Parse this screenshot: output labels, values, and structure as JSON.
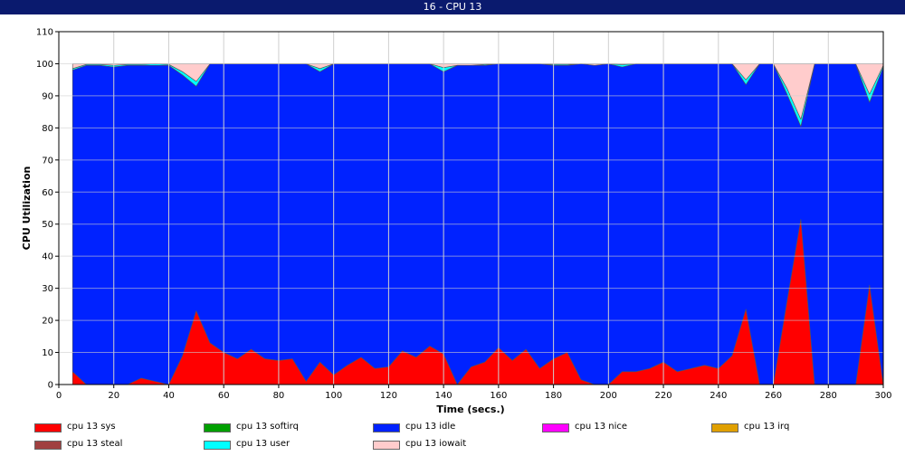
{
  "window": {
    "title": "16 - CPU 13"
  },
  "chart_data": {
    "type": "area",
    "title": "16 - CPU 13",
    "xlabel": "Time (secs.)",
    "ylabel": "CPU Utilization",
    "xlim": [
      0,
      300
    ],
    "ylim": [
      0,
      110
    ],
    "x_ticks": [
      0,
      20,
      40,
      60,
      80,
      100,
      120,
      140,
      160,
      180,
      200,
      220,
      240,
      260,
      280,
      300
    ],
    "y_ticks": [
      0,
      10,
      20,
      30,
      40,
      50,
      60,
      70,
      80,
      90,
      100,
      110
    ],
    "stacked": true,
    "grid": true,
    "legend_position": "bottom",
    "x": [
      5,
      10,
      15,
      20,
      25,
      30,
      35,
      40,
      45,
      50,
      55,
      60,
      65,
      70,
      75,
      80,
      85,
      90,
      95,
      100,
      105,
      110,
      115,
      120,
      125,
      130,
      135,
      140,
      145,
      150,
      155,
      160,
      165,
      170,
      175,
      180,
      185,
      190,
      195,
      200,
      205,
      210,
      215,
      220,
      225,
      230,
      235,
      240,
      245,
      250,
      255,
      260,
      265,
      270,
      275,
      280,
      285,
      290,
      295,
      300
    ],
    "series": [
      {
        "name": "cpu 13 sys",
        "color": "#ff0000",
        "values": [
          4,
          0,
          0,
          0,
          0,
          2,
          1,
          0,
          9,
          23,
          13,
          10,
          8,
          11,
          8,
          7.5,
          8,
          1,
          7,
          3,
          6,
          8.5,
          5,
          5.5,
          10.5,
          8.5,
          12,
          9.5,
          0,
          5.5,
          7,
          11.5,
          7.5,
          11,
          5,
          8,
          10,
          1.5,
          0,
          0,
          4,
          4,
          5,
          7,
          4,
          5,
          6,
          5,
          9,
          23.5,
          0,
          0,
          26,
          51.5,
          0,
          0,
          0,
          0,
          31,
          0
        ]
      },
      {
        "name": "cpu 13 softirq",
        "color": "#00a000",
        "values": [
          0,
          0,
          0,
          0,
          0,
          0,
          0,
          0,
          0,
          0,
          0,
          0,
          0,
          0,
          0,
          0,
          0,
          0,
          0,
          0,
          0,
          0,
          0,
          0,
          0,
          0,
          0,
          0,
          0,
          0,
          0,
          0,
          0,
          0,
          0,
          0,
          0,
          0,
          0,
          0,
          0,
          0,
          0,
          0,
          0,
          0,
          0,
          0,
          0,
          0,
          0,
          0,
          0,
          0,
          0,
          0,
          0,
          0,
          0,
          0
        ]
      },
      {
        "name": "cpu 13 idle",
        "color": "#0022ff",
        "values": [
          94,
          99.5,
          99.5,
          99,
          99.5,
          97.5,
          98.5,
          99.5,
          87.5,
          70,
          87,
          90,
          92,
          89,
          92,
          92.5,
          92,
          99,
          90.5,
          97,
          94,
          91.5,
          95,
          94.5,
          89.5,
          91.5,
          88,
          88,
          99.5,
          94,
          92.5,
          88.5,
          92.5,
          89,
          95,
          91.5,
          89.5,
          98.5,
          99.5,
          100,
          95,
          96,
          95,
          93,
          96,
          95,
          94,
          95,
          91,
          70,
          100,
          100,
          64.5,
          29,
          100,
          100,
          100,
          100,
          57,
          99
        ]
      },
      {
        "name": "cpu 13 nice",
        "color": "#ff00ff",
        "values": [
          0,
          0,
          0,
          0,
          0,
          0,
          0,
          0,
          0,
          0,
          0,
          0,
          0,
          0,
          0,
          0,
          0,
          0,
          0,
          0,
          0,
          0,
          0,
          0,
          0,
          0,
          0,
          0,
          0,
          0,
          0,
          0,
          0,
          0,
          0,
          0,
          0,
          0,
          0,
          0,
          0,
          0,
          0,
          0,
          0,
          0,
          0,
          0,
          0,
          0,
          0,
          0,
          0,
          0,
          0,
          0,
          0,
          0,
          0,
          0
        ]
      },
      {
        "name": "cpu 13 irq",
        "color": "#e0a000",
        "values": [
          0,
          0,
          0,
          0,
          0,
          0,
          0,
          0,
          0,
          0,
          0,
          0,
          0,
          0,
          0,
          0,
          0,
          0,
          0,
          0,
          0,
          0,
          0,
          0,
          0,
          0,
          0,
          0,
          0,
          0,
          0,
          0,
          0,
          0,
          0,
          0,
          0,
          0,
          0,
          0,
          0,
          0,
          0,
          0,
          0,
          0,
          0,
          0,
          0,
          0,
          0,
          0,
          0,
          0,
          0,
          0,
          0,
          0,
          0,
          0
        ]
      },
      {
        "name": "cpu 13 steal",
        "color": "#a04040",
        "values": [
          0,
          0,
          0,
          0,
          0,
          0,
          0,
          0,
          0,
          0,
          0,
          0,
          0,
          0,
          0,
          0,
          0,
          0,
          0,
          0,
          0,
          0,
          0,
          0,
          0,
          0,
          0,
          0,
          0,
          0,
          0,
          0,
          0,
          0,
          0,
          0,
          0,
          0,
          0,
          0,
          0,
          0,
          0,
          0,
          0,
          0,
          0,
          0,
          0,
          0,
          0,
          0,
          0,
          0,
          0,
          0,
          0,
          0,
          0,
          0
        ]
      },
      {
        "name": "cpu 13 user",
        "color": "#00ffff",
        "values": [
          0.5,
          0.3,
          0.3,
          0.5,
          0.3,
          0.3,
          0.5,
          0.3,
          1,
          1.5,
          0,
          0,
          0,
          0,
          0,
          0,
          0,
          0,
          1,
          0,
          0,
          0,
          0,
          0,
          0,
          0,
          0,
          1.3,
          0,
          0,
          0.3,
          0,
          0,
          0,
          0,
          0.3,
          0.3,
          0,
          0,
          0,
          0.7,
          0,
          0,
          0,
          0,
          0,
          0,
          0,
          0,
          1.5,
          0,
          0,
          1.8,
          2.2,
          0,
          0,
          0,
          0,
          2.5,
          0.5
        ]
      },
      {
        "name": "cpu 13 iowait",
        "color": "#ffcccc",
        "values": [
          1.5,
          0.2,
          0.2,
          0.5,
          0.2,
          0.2,
          0,
          0.2,
          2.5,
          5.5,
          0,
          0,
          0,
          0,
          0,
          0,
          0,
          0,
          1.5,
          0,
          0,
          0,
          0,
          0,
          0,
          0,
          0,
          1.2,
          0.5,
          0.5,
          0.2,
          0,
          0,
          0,
          0,
          0.2,
          0.2,
          0,
          0.5,
          0,
          0.3,
          0,
          0,
          0,
          0,
          0,
          0,
          0,
          0,
          5,
          0,
          0,
          7.7,
          17.3,
          0,
          0,
          0,
          0,
          9.5,
          0.5
        ]
      }
    ]
  }
}
